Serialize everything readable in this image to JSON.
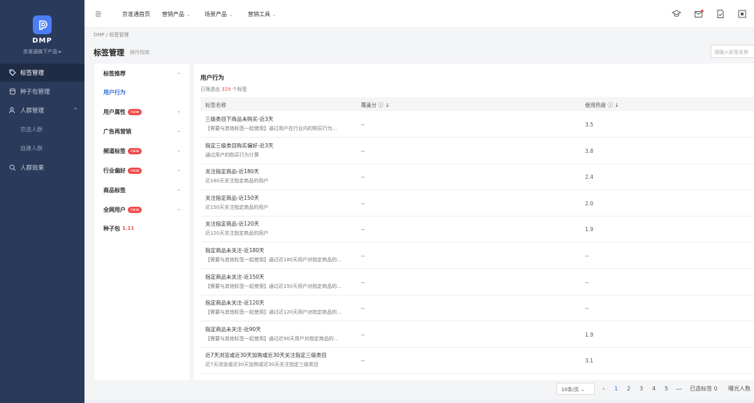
{
  "sidebar": {
    "brand": "DMP",
    "product_switch": "京准通旗下产品 ▸",
    "items": [
      {
        "label": "标签管理",
        "icon": "tag-icon",
        "active": true
      },
      {
        "label": "种子包管理",
        "icon": "database-icon",
        "active": false
      },
      {
        "label": "人群管理",
        "icon": "people-icon",
        "active": false,
        "expand": "^"
      },
      {
        "label": "京选人群",
        "sub": true
      },
      {
        "label": "自建人群",
        "sub": true
      },
      {
        "label": "人群效果",
        "icon": "magnifier-icon",
        "active": false
      }
    ]
  },
  "topbar": {
    "menu": [
      {
        "label": "京准通首页"
      },
      {
        "label": "营销产品",
        "chevron": "⌄"
      },
      {
        "label": "场景产品",
        "chevron": "⌄"
      },
      {
        "label": "营销工具",
        "chevron": "⌄"
      }
    ],
    "icons": [
      "hamburger-icon",
      "graduation-cap-icon",
      "mail-icon",
      "checklist-icon",
      "document-icon"
    ]
  },
  "breadcrumb": "DMP  /  标签管理",
  "page": {
    "title": "标签管理",
    "link": "操作指南",
    "search_placeholder": "请输入标签名称"
  },
  "categories": [
    {
      "label": "标签推荐",
      "chevron": "⌄"
    },
    {
      "label": "用户行为",
      "active": true
    },
    {
      "label": "用户属性",
      "badge": "new",
      "chevron": "⌄"
    },
    {
      "label": "广告再营销",
      "chevron": "⌄"
    },
    {
      "label": "频道标签",
      "badge": "new",
      "chevron": "⌄"
    },
    {
      "label": "行业偏好",
      "badge": "new",
      "chevron": "⌄"
    },
    {
      "label": "商品标签",
      "chevron": "⌄"
    },
    {
      "label": "全网用户",
      "badge": "new",
      "chevron": "⌄"
    },
    {
      "label": "种子包",
      "hot": "1.11"
    }
  ],
  "main": {
    "section_title": "用户行为",
    "filter_prefix": "已筛选出",
    "filter_count": "329",
    "filter_suffix": "个标签",
    "columns": [
      "标签名称",
      "覆盖分 ⓘ ↓",
      "使用热度 ⓘ ↓"
    ],
    "rows": [
      {
        "name": "三级类目下商品未购买-近3天",
        "desc": "【需要与其他标签一起使用】通过用户在行业内的购买行为...",
        "coverage": "--",
        "heat": "3.5"
      },
      {
        "name": "指定三级类目购买偏好-近3天",
        "desc": "通过用户的购买行为计算",
        "coverage": "--",
        "heat": "3.8"
      },
      {
        "name": "关注指定商品-近180天",
        "desc": "近180天关注指定商品的用户",
        "coverage": "--",
        "heat": "2.4"
      },
      {
        "name": "关注指定商品-近150天",
        "desc": "近150天关注指定商品的用户",
        "coverage": "--",
        "heat": "2.0"
      },
      {
        "name": "关注指定商品-近120天",
        "desc": "近120天关注指定商品的用户",
        "coverage": "--",
        "heat": "1.9"
      },
      {
        "name": "指定商品未关注-近180天",
        "desc": "【需要与其他标签一起使用】通过近180天用户对指定商品的...",
        "coverage": "--",
        "heat": "--"
      },
      {
        "name": "指定商品未关注-近150天",
        "desc": "【需要与其他标签一起使用】通过近150天用户对指定商品的...",
        "coverage": "--",
        "heat": "--"
      },
      {
        "name": "指定商品未关注-近120天",
        "desc": "【需要与其他标签一起使用】通过近120天用户对指定商品的...",
        "coverage": "--",
        "heat": "--"
      },
      {
        "name": "指定商品未关注-近90天",
        "desc": "【需要与其他标签一起使用】通过近90天用户对指定商品的...",
        "coverage": "--",
        "heat": "1.9"
      },
      {
        "name": "近7天浏览或近30天加购或近30天关注指定三级类目",
        "desc": "近7天浏览或近30天加购或近30天关注指定三级类目",
        "coverage": "--",
        "heat": "3.1"
      }
    ]
  },
  "pagination": {
    "page_size": "10条/页 ⌄",
    "prev": "‹",
    "pages": [
      "1",
      "2",
      "3",
      "4",
      "5"
    ],
    "ellipsis": "•••",
    "current": "1"
  },
  "footer": {
    "selected": "已选标签 0",
    "exposure": "曝光人数"
  },
  "colors": {
    "sidebar": "#2a3a5a",
    "accent": "#2f6bd9",
    "badge": "#f04b4b"
  }
}
